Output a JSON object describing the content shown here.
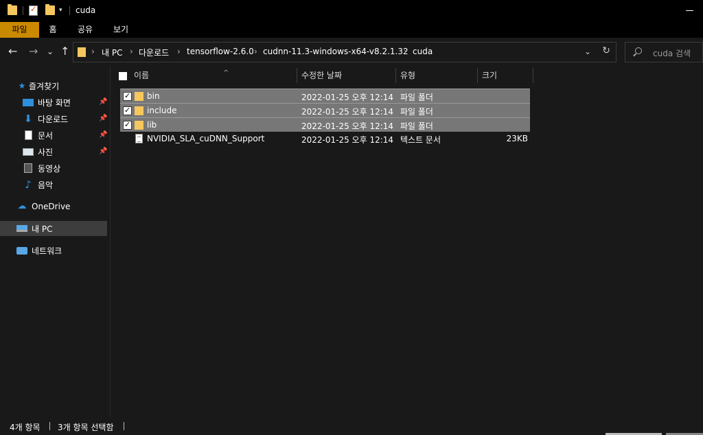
{
  "titlebar": {
    "title": "cuda",
    "dropdown": "▾"
  },
  "ribbon": {
    "tabs": [
      {
        "label": "파일"
      },
      {
        "label": "홈"
      },
      {
        "label": "공유"
      },
      {
        "label": "보기"
      }
    ]
  },
  "nav": {
    "back": "←",
    "forward": "→",
    "recent": "⌄",
    "up": "↑"
  },
  "address": {
    "crumbs": [
      "내 PC",
      "다운로드",
      "tensorflow-2.6.0",
      "cudnn-11.3-windows-x64-v8.2.1.32",
      "cuda"
    ],
    "separator": "›",
    "chevron": "⌄",
    "refresh": "↻"
  },
  "search": {
    "placeholder": "cuda 검색"
  },
  "sidebar": {
    "quick_access": "즐겨찾기",
    "items": [
      {
        "label": "바탕 화면",
        "icon": "desktop-icon",
        "pinned": true
      },
      {
        "label": "다운로드",
        "icon": "download-icon",
        "pinned": true
      },
      {
        "label": "문서",
        "icon": "document-icon",
        "pinned": true
      },
      {
        "label": "사진",
        "icon": "pictures-icon",
        "pinned": true
      },
      {
        "label": "동영상",
        "icon": "video-icon",
        "pinned": false
      },
      {
        "label": "음악",
        "icon": "music-icon",
        "pinned": false
      }
    ],
    "onedrive": "OneDrive",
    "this_pc": "내 PC",
    "network": "네트워크",
    "pin_glyph": "📌"
  },
  "columns": {
    "name": "이름",
    "modified": "수정한 날짜",
    "type": "유형",
    "size": "크기",
    "sort_glyph": "^"
  },
  "files": [
    {
      "name": "bin",
      "modified": "2022-01-25 오후 12:14",
      "type": "파일 폴더",
      "size": "",
      "kind": "folder",
      "selected": true
    },
    {
      "name": "include",
      "modified": "2022-01-25 오후 12:14",
      "type": "파일 폴더",
      "size": "",
      "kind": "folder",
      "selected": true
    },
    {
      "name": "lib",
      "modified": "2022-01-25 오후 12:14",
      "type": "파일 폴더",
      "size": "",
      "kind": "folder",
      "selected": true
    },
    {
      "name": "NVIDIA_SLA_cuDNN_Support",
      "modified": "2022-01-25 오후 12:14",
      "type": "텍스트 문서",
      "size": "23KB",
      "kind": "text",
      "selected": false
    }
  ],
  "status": {
    "count": "4개 항목",
    "selected": "3개 항목 선택함",
    "sep": "|"
  },
  "colors": {
    "accent_tab": "#ca8a00",
    "folder": "#f5c75d",
    "selected_row": "#777777",
    "background": "#191919"
  }
}
